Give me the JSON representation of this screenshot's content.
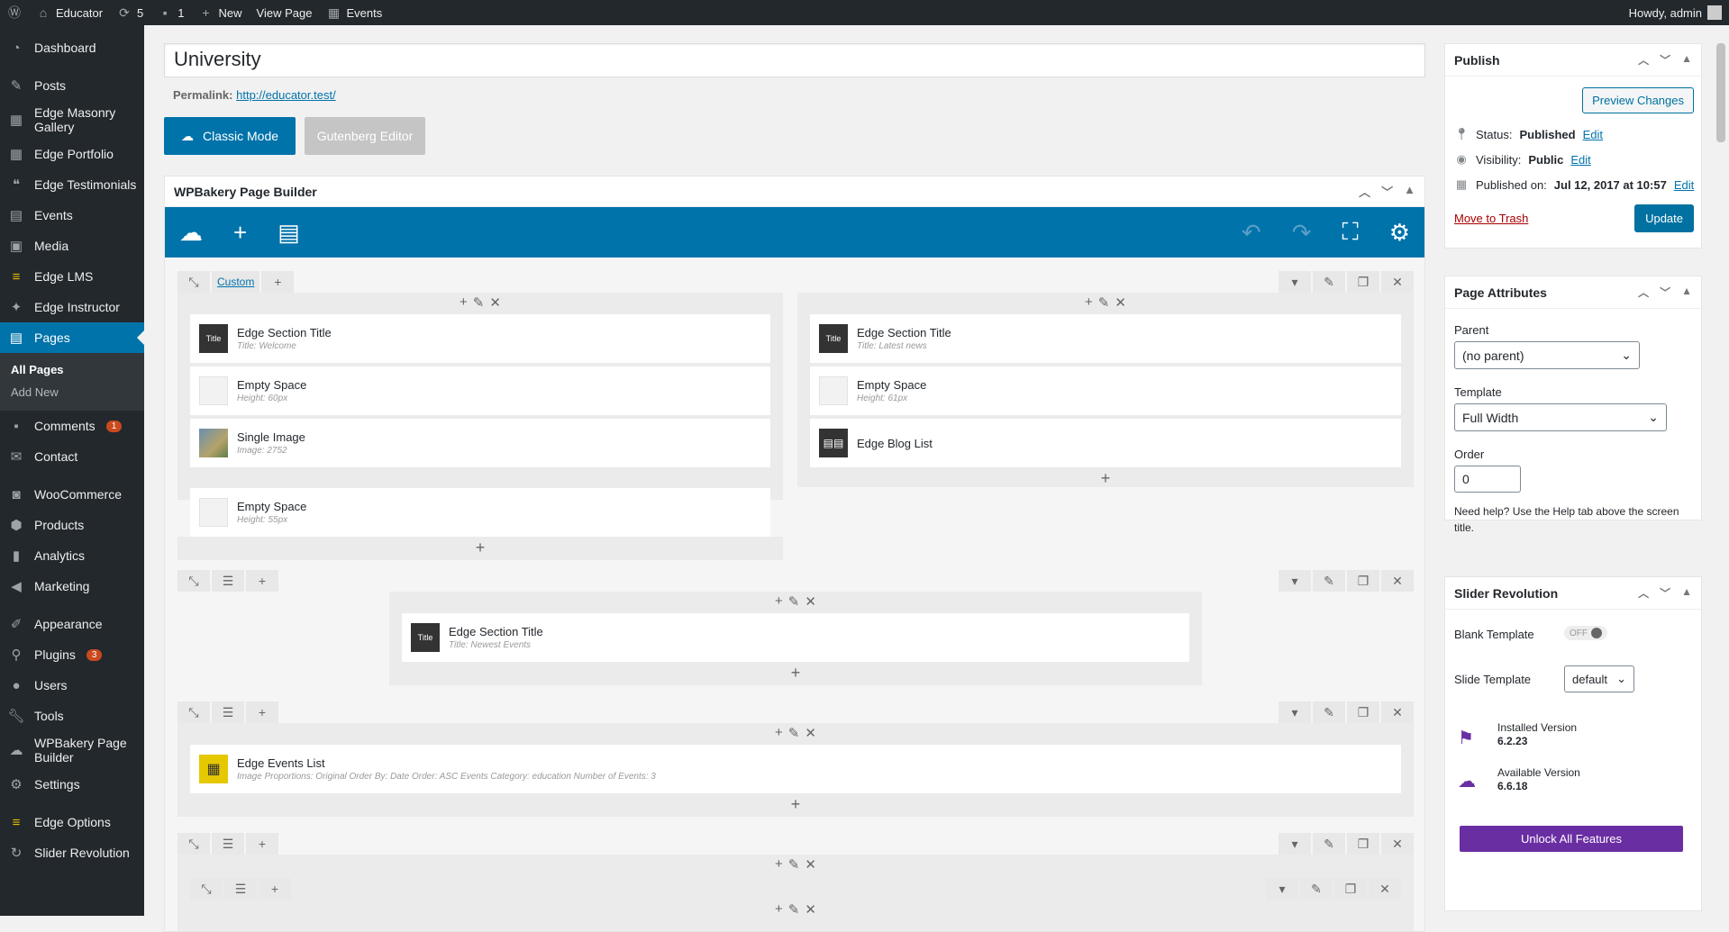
{
  "adminbar": {
    "site": "Educator",
    "updates": "5",
    "comments": "1",
    "new": "New",
    "view": "View Page",
    "events": "Events",
    "howdy": "Howdy, admin"
  },
  "sidebar": {
    "items": [
      {
        "label": "Dashboard",
        "icon": "dashboard-icon"
      },
      {
        "label": "Posts",
        "icon": "pin-icon"
      },
      {
        "label": "Edge Masonry Gallery",
        "icon": "grid-icon"
      },
      {
        "label": "Edge Portfolio",
        "icon": "grid-icon"
      },
      {
        "label": "Edge Testimonials",
        "icon": "quote-icon"
      },
      {
        "label": "Events",
        "icon": "calendar-icon"
      },
      {
        "label": "Media",
        "icon": "media-icon"
      },
      {
        "label": "Edge LMS",
        "icon": "edge-icon"
      },
      {
        "label": "Edge Instructor",
        "icon": "pin-icon"
      },
      {
        "label": "Pages",
        "icon": "pages-icon"
      }
    ],
    "submenu": [
      "All Pages",
      "Add New"
    ],
    "items2": [
      {
        "label": "Comments",
        "badge": "1"
      },
      {
        "label": "Contact"
      },
      {
        "label": "WooCommerce"
      },
      {
        "label": "Products"
      },
      {
        "label": "Analytics"
      },
      {
        "label": "Marketing"
      },
      {
        "label": "Appearance"
      },
      {
        "label": "Plugins",
        "badge": "3"
      },
      {
        "label": "Users"
      },
      {
        "label": "Tools"
      },
      {
        "label": "WPBakery Page Builder"
      },
      {
        "label": "Settings"
      },
      {
        "label": "Edge Options"
      },
      {
        "label": "Slider Revolution"
      }
    ]
  },
  "editor": {
    "title": "University",
    "permalink_label": "Permalink:",
    "permalink_url": "http://educator.test/",
    "classic_mode": "Classic Mode",
    "gutenberg": "Gutenberg Editor"
  },
  "wpb": {
    "title": "WPBakery Page Builder",
    "custom_link": "Custom",
    "elements": {
      "r1c1": [
        {
          "name": "Edge Section Title",
          "sub": "Title: Welcome"
        },
        {
          "name": "Empty Space",
          "sub": "Height: 60px"
        },
        {
          "name": "Single Image",
          "sub": "Image: 2752"
        },
        {
          "name": "Empty Space",
          "sub": "Height: 55px"
        }
      ],
      "r1c2": [
        {
          "name": "Edge Section Title",
          "sub": "Title: Latest news"
        },
        {
          "name": "Empty Space",
          "sub": "Height: 61px"
        },
        {
          "name": "Edge Blog List",
          "sub": ""
        }
      ],
      "r2": {
        "name": "Edge Section Title",
        "sub": "Title: Newest Events"
      },
      "r3": {
        "name": "Edge Events List",
        "sub": "Image Proportions: Original  Order By: Date  Order: ASC  Events Category: education  Number of Events: 3"
      }
    },
    "title_icon_text": "Title"
  },
  "publish": {
    "title": "Publish",
    "preview": "Preview Changes",
    "status_label": "Status:",
    "status_value": "Published",
    "visibility_label": "Visibility:",
    "visibility_value": "Public",
    "published_label": "Published on:",
    "published_value": "Jul 12, 2017 at 10:57",
    "edit": "Edit",
    "trash": "Move to Trash",
    "update": "Update"
  },
  "attributes": {
    "title": "Page Attributes",
    "parent_label": "Parent",
    "parent_value": "(no parent)",
    "template_label": "Template",
    "template_value": "Full Width",
    "order_label": "Order",
    "order_value": "0",
    "help": "Need help? Use the Help tab above the screen title."
  },
  "slider": {
    "title": "Slider Revolution",
    "blank_label": "Blank Template",
    "blank_value": "OFF",
    "slide_label": "Slide Template",
    "slide_value": "default",
    "installed_label": "Installed Version",
    "installed_value": "6.2.23",
    "available_label": "Available Version",
    "available_value": "6.6.18",
    "unlock": "Unlock All Features"
  }
}
